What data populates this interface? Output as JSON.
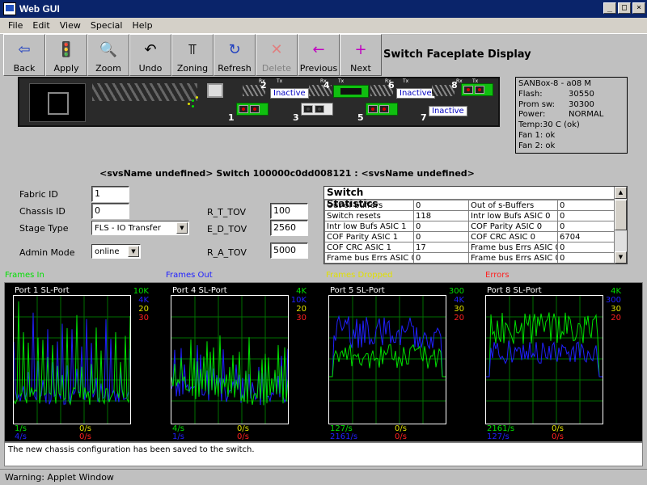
{
  "window": {
    "title": "Web GUI",
    "controls": [
      "_",
      "□",
      "×"
    ]
  },
  "menu": [
    "File",
    "Edit",
    "View",
    "Special",
    "Help"
  ],
  "toolbar": [
    {
      "label": "Back",
      "icon": "back-arrow-icon",
      "glyph": "⇦",
      "color": "#2040c0",
      "enabled": true
    },
    {
      "label": "Apply",
      "icon": "traffic-light-icon",
      "glyph": "🚦",
      "color": "#c0a000",
      "enabled": true
    },
    {
      "label": "Zoom",
      "icon": "magnifier-icon",
      "glyph": "🔍",
      "color": "#000000",
      "enabled": true
    },
    {
      "label": "Undo",
      "icon": "undo-icon",
      "glyph": "↶",
      "color": "#000000",
      "enabled": true
    },
    {
      "label": "Zoning",
      "icon": "zoning-icon",
      "glyph": "⫪",
      "color": "#000000",
      "enabled": true
    },
    {
      "label": "Refresh",
      "icon": "refresh-icon",
      "glyph": "↻",
      "color": "#2040c0",
      "enabled": true
    },
    {
      "label": "Delete",
      "icon": "delete-icon",
      "glyph": "✕",
      "color": "#e08080",
      "enabled": false
    },
    {
      "label": "Previous",
      "icon": "previous-icon",
      "glyph": "←",
      "color": "#c000c0",
      "enabled": true
    },
    {
      "label": "Next",
      "icon": "next-icon",
      "glyph": "+",
      "color": "#c000c0",
      "enabled": true
    }
  ],
  "faceplate_title": "Switch Faceplate Display",
  "faceplate": {
    "inactive_label": "Inactive",
    "port_numbers": [
      "1",
      "2",
      "3",
      "4",
      "5",
      "6",
      "7",
      "8"
    ],
    "rx": "Rx",
    "tx": "Tx"
  },
  "info": {
    "model": "SANBox-8 - a08 M",
    "flash_label": "Flash:",
    "flash": "30550",
    "prom_label": "Prom sw:",
    "prom": "30300",
    "power_label": "Power:",
    "power": "NORMAL",
    "temp": "Temp:30 C (ok)",
    "fan1": "Fan 1: ok",
    "fan2": "Fan 2: ok"
  },
  "switch_heading": "<svsName undefined> Switch 100000c0dd008121 : <svsName undefined>",
  "config": {
    "fabric_id_label": "Fabric ID",
    "fabric_id": "1",
    "chassis_id_label": "Chassis ID",
    "chassis_id": "0",
    "stage_type_label": "Stage Type",
    "stage_type": "FLS - IO Transfer",
    "admin_mode_label": "Admin Mode",
    "admin_mode": "online",
    "rttov_label": "R_T_TOV",
    "rttov": "100",
    "edtov_label": "E_D_TOV",
    "edtov": "2560",
    "ratov_label": "R_A_TOV",
    "ratov": "5000"
  },
  "stats": {
    "title": "Switch Statistics",
    "rows": [
      [
        "Out of buffers",
        "0",
        "Out of s-Buffers",
        "0"
      ],
      [
        "Switch resets",
        "118",
        "Intr low Bufs ASIC 0",
        "0"
      ],
      [
        "Intr low Bufs ASIC 1",
        "0",
        "COF Parity ASIC 0",
        "0"
      ],
      [
        "COF Parity ASIC 1",
        "0",
        "COF CRC ASIC 0",
        "6704"
      ],
      [
        "COF CRC ASIC 1",
        "17",
        "Frame bus Errs ASIC 0",
        "0"
      ],
      [
        "Frame bus Errs ASIC 0",
        "0",
        "Frame bus Errs ASIC 0",
        "0"
      ]
    ]
  },
  "legend": [
    {
      "label": "Frames In",
      "color": "#00e000"
    },
    {
      "label": "Frames Out",
      "color": "#2020ff"
    },
    {
      "label": "Frames Dropped",
      "color": "#e0e000"
    },
    {
      "label": "Errors",
      "color": "#ff2020"
    }
  ],
  "charts": [
    {
      "label": "Port 1 SL-Port",
      "scales": [
        "10K",
        "4K",
        "20",
        "30"
      ],
      "rates": [
        "1/s",
        "4/s",
        "0/s",
        "0/s"
      ],
      "profile": "low"
    },
    {
      "label": "Port 4 SL-Port",
      "scales": [
        "4K",
        "10K",
        "20",
        "30"
      ],
      "rates": [
        "4/s",
        "1/s",
        "0/s",
        "0/s"
      ],
      "profile": "mid"
    },
    {
      "label": "Port 5 SL-Port",
      "scales": [
        "300",
        "4K",
        "30",
        "20"
      ],
      "rates": [
        "127/s",
        "2161/s",
        "0/s",
        "0/s"
      ],
      "profile": "high"
    },
    {
      "label": "Port 8 SL-Port",
      "scales": [
        "4K",
        "300",
        "30",
        "20"
      ],
      "rates": [
        "2161/s",
        "127/s",
        "0/s",
        "0/s"
      ],
      "profile": "high2"
    }
  ],
  "message": "The new chassis configuration has been saved to the switch.",
  "status": "Warning: Applet Window"
}
